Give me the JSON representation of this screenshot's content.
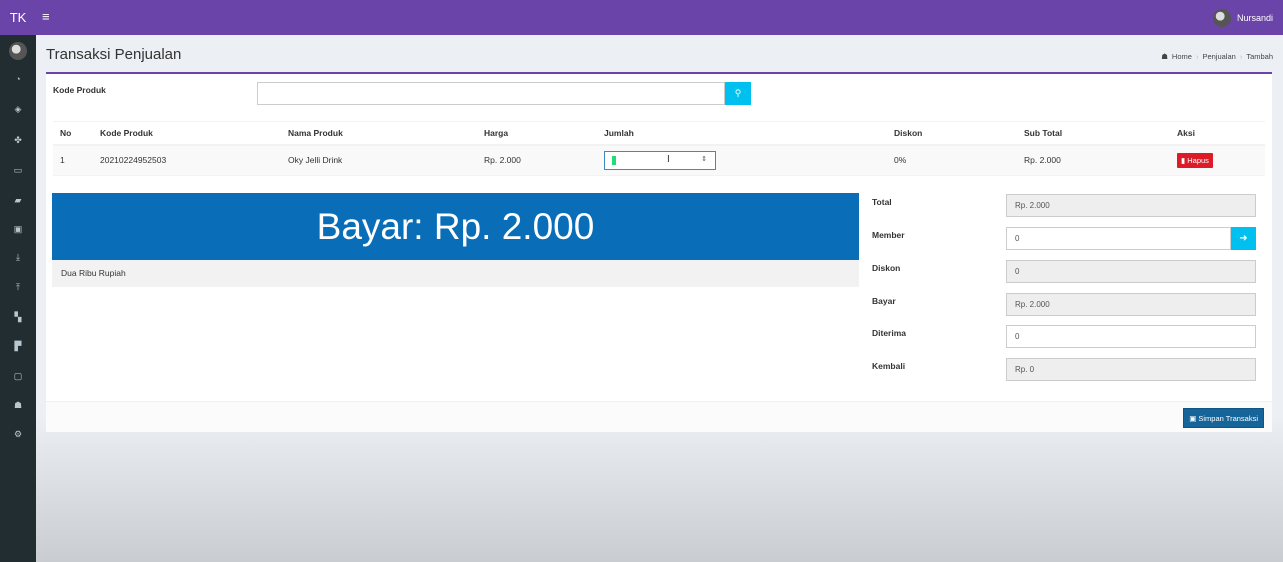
{
  "navbar": {
    "brand": "TK",
    "menu_icon": "≡",
    "user_name": "Nursandi"
  },
  "sidebar": {
    "items": [
      {
        "name": "dashboard-icon",
        "glyph": "◔"
      },
      {
        "name": "cube-icon",
        "glyph": "◈"
      },
      {
        "name": "cubes-icon",
        "glyph": "✤"
      },
      {
        "name": "card-icon",
        "glyph": "▭"
      },
      {
        "name": "truck-icon",
        "glyph": "▰"
      },
      {
        "name": "money-icon",
        "glyph": "▣"
      },
      {
        "name": "download-icon",
        "glyph": "⤓"
      },
      {
        "name": "upload-icon",
        "glyph": "⤒"
      },
      {
        "name": "cart-icon",
        "glyph": "▚"
      },
      {
        "name": "cart-plus-icon",
        "glyph": "▛"
      },
      {
        "name": "pdf-icon",
        "glyph": "▢"
      },
      {
        "name": "users-icon",
        "glyph": "☗"
      },
      {
        "name": "cogs-icon",
        "glyph": "⚙"
      }
    ]
  },
  "page": {
    "title": "Transaksi Penjualan",
    "breadcrumb": {
      "home": "Home",
      "middle": "Penjualan",
      "current": "Tambah"
    }
  },
  "form": {
    "kode_produk_label": "Kode Produk",
    "kode_produk_value": ""
  },
  "table": {
    "headers": [
      "No",
      "Kode Produk",
      "Nama Produk",
      "Harga",
      "Jumlah",
      "Diskon",
      "Sub Total",
      "Aksi"
    ],
    "rows": [
      {
        "no": "1",
        "kode": "20210224952503",
        "nama": "Oky Jelli Drink",
        "harga": "Rp. 2.000",
        "jumlah": "1",
        "diskon": "0%",
        "subtotal": "Rp. 2.000",
        "aksi": "Hapus"
      }
    ]
  },
  "bayar_banner": "Bayar: Rp. 2.000",
  "terbilang": "Dua Ribu Rupiah",
  "summary": {
    "total_label": "Total",
    "total": "Rp. 2.000",
    "member_label": "Member",
    "member": "0",
    "diskon_label": "Diskon",
    "diskon": "0",
    "bayar_label": "Bayar",
    "bayar": "Rp. 2.000",
    "diterima_label": "Diterima",
    "diterima": "0",
    "kembali_label": "Kembali",
    "kembali": "Rp. 0"
  },
  "save_button": "Simpan Transaksi",
  "colors": {
    "navbar": "#6a44a8",
    "sidebar": "#222d32",
    "banner": "#0a6db7",
    "info": "#00c0ef",
    "danger": "#dd1c2a"
  }
}
